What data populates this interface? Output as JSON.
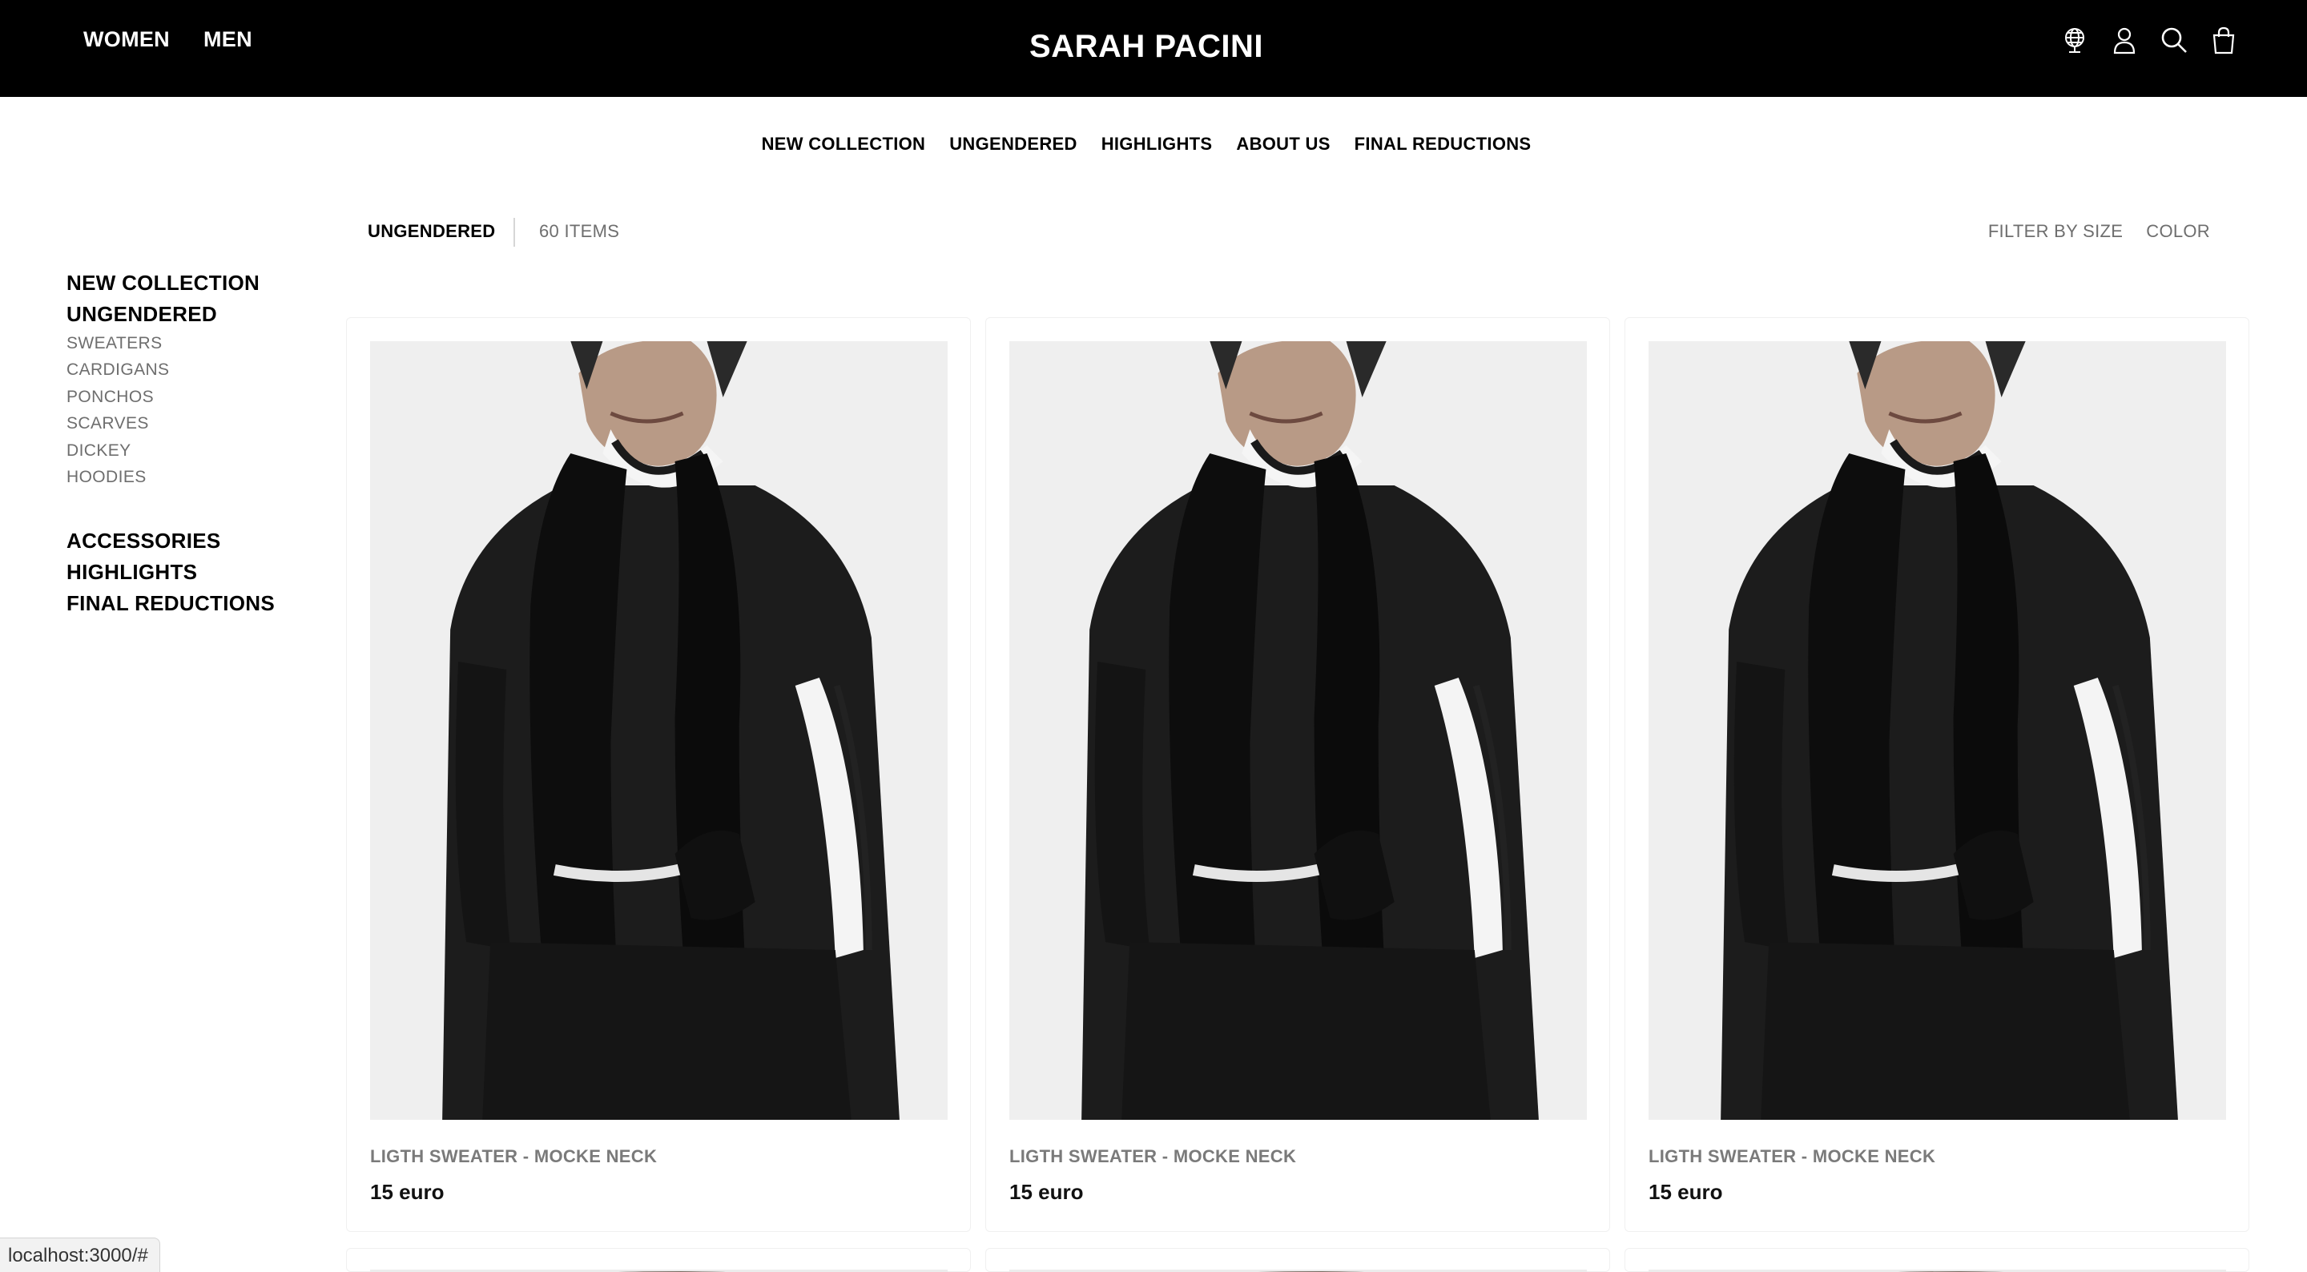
{
  "header": {
    "gender_links": [
      "WOMEN",
      "MEN"
    ],
    "brand": "SARAH PACINI",
    "icons": [
      "globe-icon",
      "user-icon",
      "search-icon",
      "bag-icon"
    ]
  },
  "main_nav": [
    "NEW COLLECTION",
    "UNGENDERED",
    "HIGHLIGHTS",
    "ABOUT US",
    "FINAL REDUCTIONS"
  ],
  "sidebar": {
    "sections": [
      "NEW COLLECTION",
      "UNGENDERED"
    ],
    "subcategories": [
      "SWEATERS",
      "CARDIGANS",
      "PONCHOS",
      "SCARVES",
      "DICKEY",
      "HOODIES"
    ],
    "more_sections": [
      "ACCESSORIES",
      "HIGHLIGHTS",
      "FINAL REDUCTIONS"
    ]
  },
  "toolbar": {
    "category": "UNGENDERED",
    "count": "60 ITEMS",
    "filter_size": "FILTER BY SIZE",
    "filter_color": "COLOR"
  },
  "products": [
    {
      "name": "LIGTH SWEATER - MOCKE NECK",
      "price": "15 euro"
    },
    {
      "name": "LIGTH SWEATER - MOCKE NECK",
      "price": "15 euro"
    },
    {
      "name": "LIGTH SWEATER - MOCKE NECK",
      "price": "15 euro"
    }
  ],
  "status_bar": "localhost:3000/#"
}
